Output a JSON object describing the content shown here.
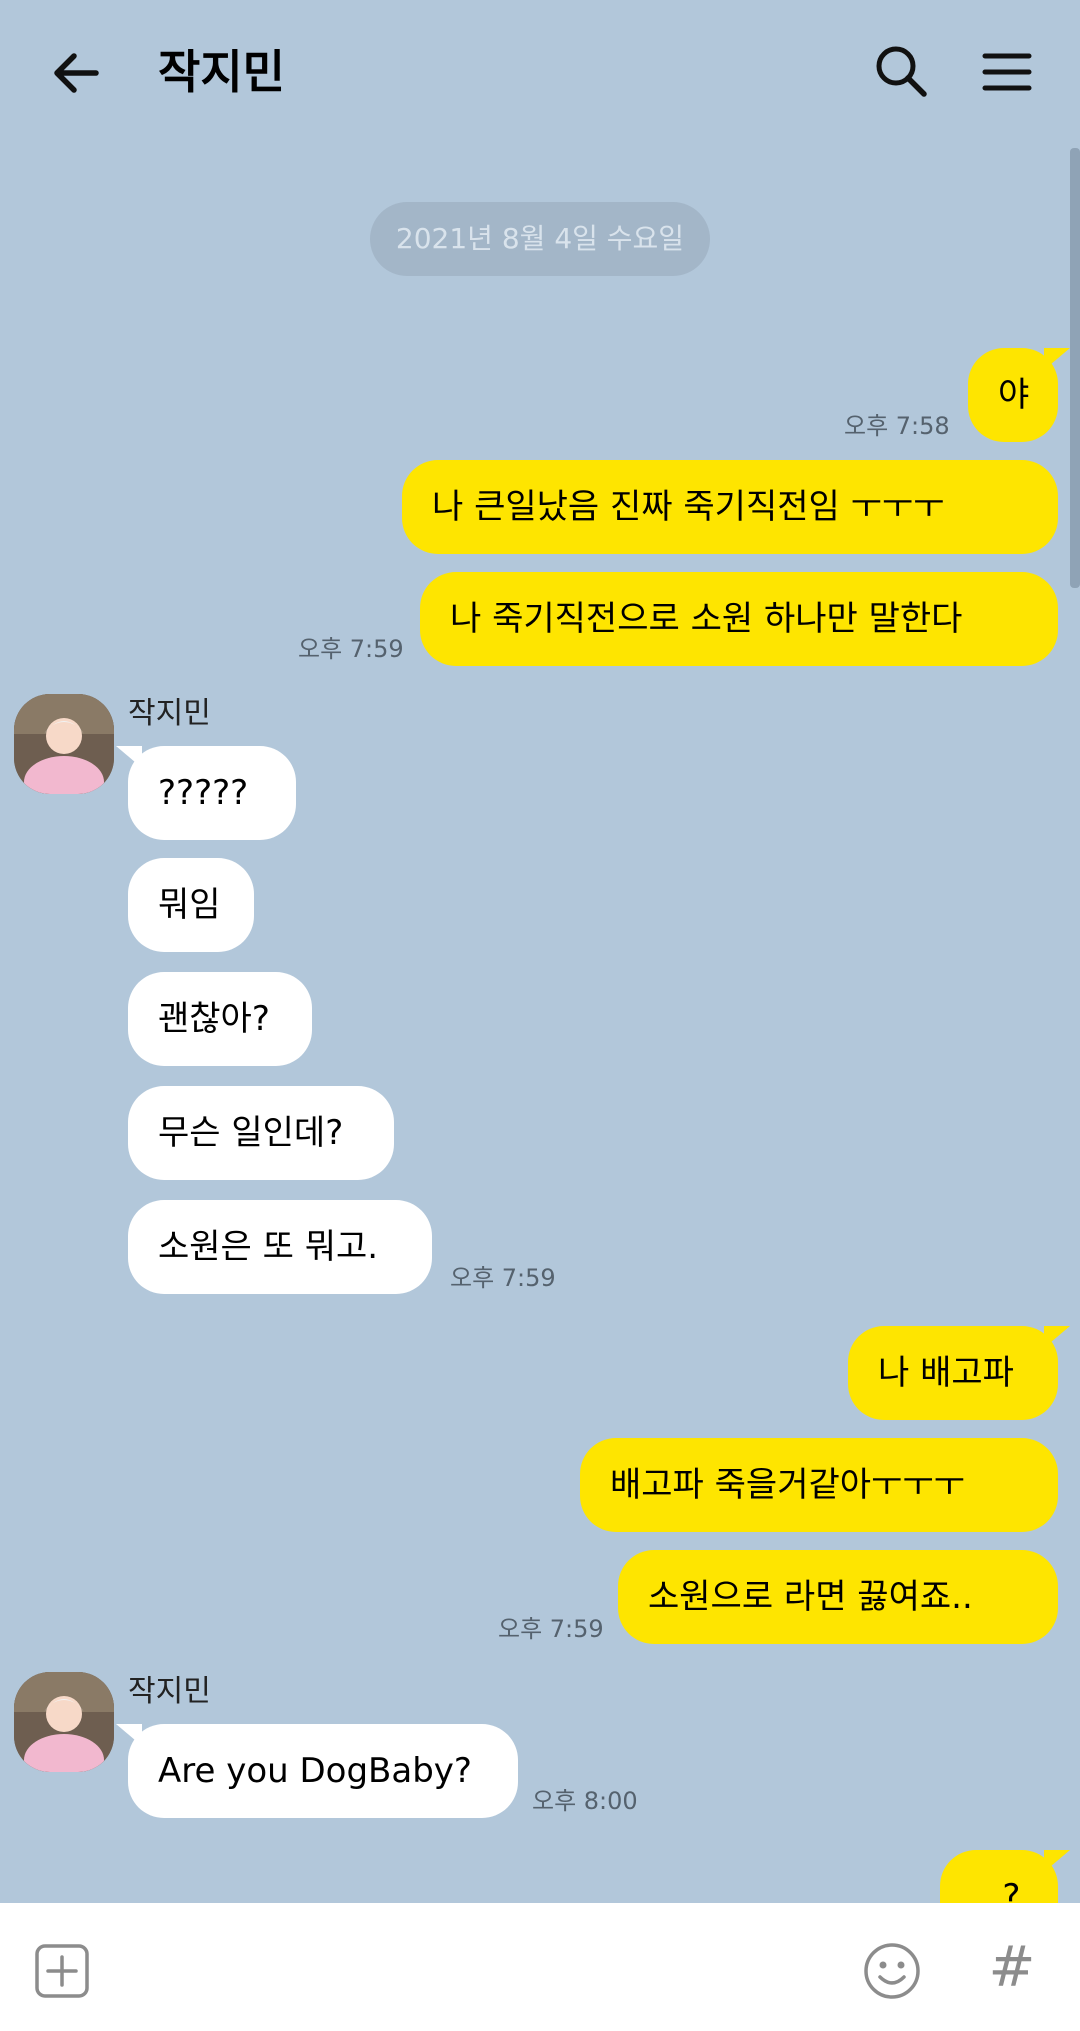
{
  "header": {
    "title": "작지민"
  },
  "date_divider": "2021년 8월 4일 수요일",
  "messages": {
    "m1": {
      "text": "야"
    },
    "t1": "오후 7:58",
    "m2": {
      "text": "나 큰일났음 진짜 죽기직전임 ㅜㅜㅜ"
    },
    "m3": {
      "text": "나 죽기직전으로 소원 하나만 말한다"
    },
    "t2": "오후 7:59",
    "sender1": "작지민",
    "r1": {
      "text": "?????"
    },
    "r2": {
      "text": "뭐임"
    },
    "r3": {
      "text": "괜찮아?"
    },
    "r4": {
      "text": "무슨 일인데?"
    },
    "r5": {
      "text": "소원은 또 뭐고."
    },
    "t3": "오후 7:59",
    "m4": {
      "text": "나 배고파"
    },
    "m5": {
      "text": "배고파 죽을거같아ㅜㅜㅜ"
    },
    "m6": {
      "text": "소원으로 라면 끓여죠.."
    },
    "t4": "오후 7:59",
    "sender2": "작지민",
    "r6": {
      "text": "Are you DogBaby?"
    },
    "t5": "오후 8:00",
    "m7": {
      "text": "...?"
    }
  },
  "icons": {
    "back": "arrow-left-icon",
    "search": "search-icon",
    "menu": "menu-icon",
    "plus": "plus-icon",
    "emoji": "emoji-icon",
    "hash": "hash-icon"
  },
  "bottom_bar": {
    "hash_glyph": "#"
  },
  "colors": {
    "background": "#b2c7da",
    "my_bubble": "#fee500",
    "their_bubble": "#ffffff"
  }
}
